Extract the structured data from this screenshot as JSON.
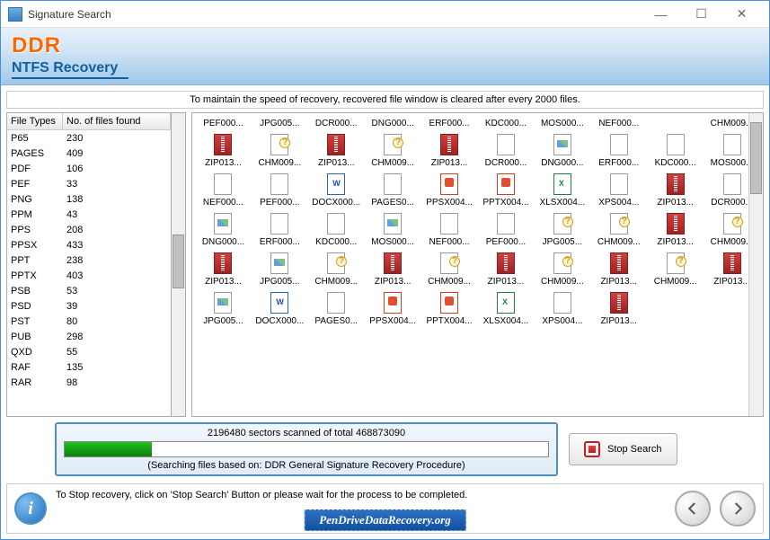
{
  "window": {
    "title": "Signature Search"
  },
  "header": {
    "logo": "DDR",
    "subtitle": "NTFS Recovery"
  },
  "info_msg": "To maintain the speed of recovery, recovered file window is cleared after every 2000 files.",
  "table": {
    "col1": "File Types",
    "col2": "No. of files found",
    "rows": [
      {
        "type": "P65",
        "count": "230"
      },
      {
        "type": "PAGES",
        "count": "409"
      },
      {
        "type": "PDF",
        "count": "106"
      },
      {
        "type": "PEF",
        "count": "33"
      },
      {
        "type": "PNG",
        "count": "138"
      },
      {
        "type": "PPM",
        "count": "43"
      },
      {
        "type": "PPS",
        "count": "208"
      },
      {
        "type": "PPSX",
        "count": "433"
      },
      {
        "type": "PPT",
        "count": "238"
      },
      {
        "type": "PPTX",
        "count": "403"
      },
      {
        "type": "PSB",
        "count": "53"
      },
      {
        "type": "PSD",
        "count": "39"
      },
      {
        "type": "PST",
        "count": "80"
      },
      {
        "type": "PUB",
        "count": "298"
      },
      {
        "type": "QXD",
        "count": "55"
      },
      {
        "type": "RAF",
        "count": "135"
      },
      {
        "type": "RAR",
        "count": "98"
      }
    ]
  },
  "files": {
    "row0": [
      {
        "n": "PEF000...",
        "i": "page"
      },
      {
        "n": "JPG005...",
        "i": "page"
      },
      {
        "n": "DCR000...",
        "i": "page"
      },
      {
        "n": "DNG000...",
        "i": "page"
      },
      {
        "n": "ERF000...",
        "i": "page"
      },
      {
        "n": "KDC000...",
        "i": "page"
      },
      {
        "n": "MOS000...",
        "i": "page"
      },
      {
        "n": "NEF000...",
        "i": "page"
      },
      {
        "n": "",
        "i": "page"
      },
      {
        "n": "CHM009...",
        "i": "page"
      }
    ],
    "row1": [
      {
        "n": "ZIP013...",
        "i": "zip"
      },
      {
        "n": "CHM009...",
        "i": "q"
      },
      {
        "n": "ZIP013...",
        "i": "zip"
      },
      {
        "n": "CHM009...",
        "i": "q"
      },
      {
        "n": "ZIP013...",
        "i": "zip"
      },
      {
        "n": "DCR000...",
        "i": "page"
      },
      {
        "n": "DNG000...",
        "i": "img"
      },
      {
        "n": "ERF000...",
        "i": "page"
      },
      {
        "n": "KDC000...",
        "i": "page"
      },
      {
        "n": "MOS000...",
        "i": "page"
      }
    ],
    "row2": [
      {
        "n": "NEF000...",
        "i": "page"
      },
      {
        "n": "PEF000...",
        "i": "page"
      },
      {
        "n": "DOCX000...",
        "i": "doc"
      },
      {
        "n": "PAGES0...",
        "i": "page"
      },
      {
        "n": "PPSX004...",
        "i": "ppt"
      },
      {
        "n": "PPTX004...",
        "i": "ppt"
      },
      {
        "n": "XLSX004...",
        "i": "xls"
      },
      {
        "n": "XPS004...",
        "i": "page"
      },
      {
        "n": "ZIP013...",
        "i": "zip"
      },
      {
        "n": "DCR000...",
        "i": "page"
      }
    ],
    "row3": [
      {
        "n": "DNG000...",
        "i": "img"
      },
      {
        "n": "ERF000...",
        "i": "page"
      },
      {
        "n": "KDC000...",
        "i": "page"
      },
      {
        "n": "MOS000...",
        "i": "img"
      },
      {
        "n": "NEF000...",
        "i": "page"
      },
      {
        "n": "PEF000...",
        "i": "page"
      },
      {
        "n": "JPG005...",
        "i": "q"
      },
      {
        "n": "CHM009...",
        "i": "q"
      },
      {
        "n": "ZIP013...",
        "i": "zip"
      },
      {
        "n": "CHM009...",
        "i": "q"
      }
    ],
    "row4": [
      {
        "n": "ZIP013...",
        "i": "zip"
      },
      {
        "n": "JPG005...",
        "i": "img"
      },
      {
        "n": "CHM009...",
        "i": "q"
      },
      {
        "n": "ZIP013...",
        "i": "zip"
      },
      {
        "n": "CHM009...",
        "i": "q"
      },
      {
        "n": "ZIP013...",
        "i": "zip"
      },
      {
        "n": "CHM009...",
        "i": "q"
      },
      {
        "n": "ZIP013...",
        "i": "zip"
      },
      {
        "n": "CHM009...",
        "i": "q"
      },
      {
        "n": "ZIP013...",
        "i": "zip"
      }
    ],
    "row5": [
      {
        "n": "JPG005...",
        "i": "img"
      },
      {
        "n": "DOCX000...",
        "i": "doc"
      },
      {
        "n": "PAGES0...",
        "i": "page"
      },
      {
        "n": "PPSX004...",
        "i": "ppt"
      },
      {
        "n": "PPTX004...",
        "i": "ppt"
      },
      {
        "n": "XLSX004...",
        "i": "xls"
      },
      {
        "n": "XPS004...",
        "i": "page"
      },
      {
        "n": "ZIP013...",
        "i": "zip"
      },
      {
        "n": "",
        "i": ""
      },
      {
        "n": "",
        "i": ""
      }
    ]
  },
  "progress": {
    "text": "2196480 sectors scanned of total 468873090",
    "subtext": "(Searching files based on:  DDR General Signature Recovery Procedure)",
    "percent": 18
  },
  "stop_label": "Stop Search",
  "footer": {
    "hint": "To Stop recovery, click on 'Stop Search' Button or please wait for the process to be completed.",
    "website": "PenDriveDataRecovery.org"
  }
}
